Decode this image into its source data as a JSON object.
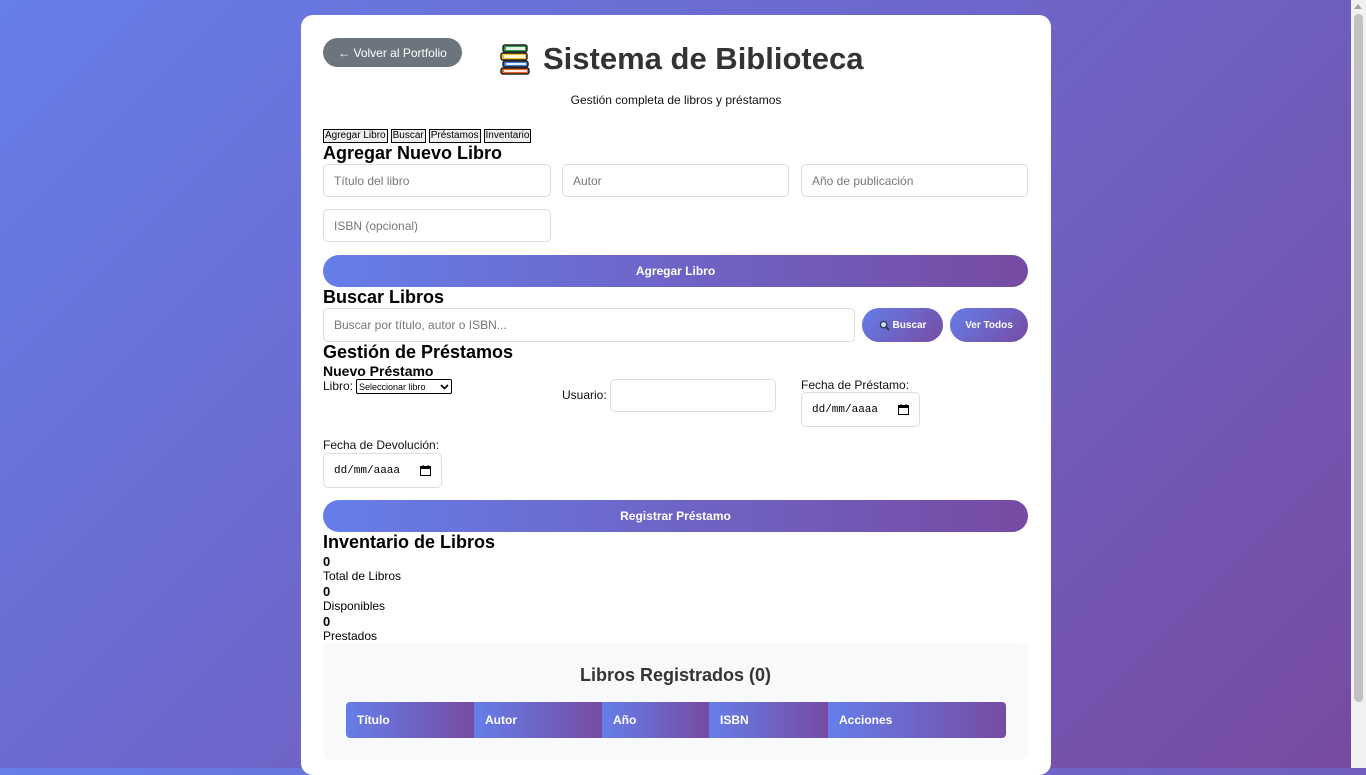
{
  "header": {
    "back_label": "← Volver al Portfolio",
    "title": "Sistema de Biblioteca",
    "subtitle": "Gestión completa de libros y préstamos"
  },
  "tabs": [
    "Agregar Libro",
    "Buscar",
    "Préstamos",
    "Inventario"
  ],
  "add_book": {
    "heading": "Agregar Nuevo Libro",
    "title_placeholder": "Título del libro",
    "author_placeholder": "Autor",
    "year_placeholder": "Año de publicación",
    "isbn_placeholder": "ISBN (opcional)",
    "submit_label": "Agregar Libro"
  },
  "search": {
    "heading": "Buscar Libros",
    "placeholder": "Buscar por título, autor o ISBN...",
    "search_label": "Buscar",
    "show_all_label": "Ver Todos"
  },
  "loans": {
    "heading": "Gestión de Préstamos",
    "subheading": "Nuevo Préstamo",
    "book_label": "Libro:",
    "book_select_value": "Seleccionar libro",
    "user_label": "Usuario:",
    "loan_date_label": "Fecha de Préstamo:",
    "loan_date_value": "dd/mm/aaaa",
    "return_date_label": "Fecha de Devolución:",
    "return_date_value": "dd/mm/aaaa",
    "submit_label": "Registrar Préstamo"
  },
  "inventory": {
    "heading": "Inventario de Libros",
    "stats": [
      {
        "value": "0",
        "label": "Total de Libros"
      },
      {
        "value": "0",
        "label": "Disponibles"
      },
      {
        "value": "0",
        "label": "Prestados"
      }
    ]
  },
  "books_table": {
    "title": "Libros Registrados (0)",
    "columns": [
      "Título",
      "Autor",
      "Año",
      "ISBN",
      "Acciones"
    ]
  },
  "colors": {
    "gradient_start": "#667eea",
    "gradient_end": "#764ba2",
    "back_button": "#6c757d"
  }
}
